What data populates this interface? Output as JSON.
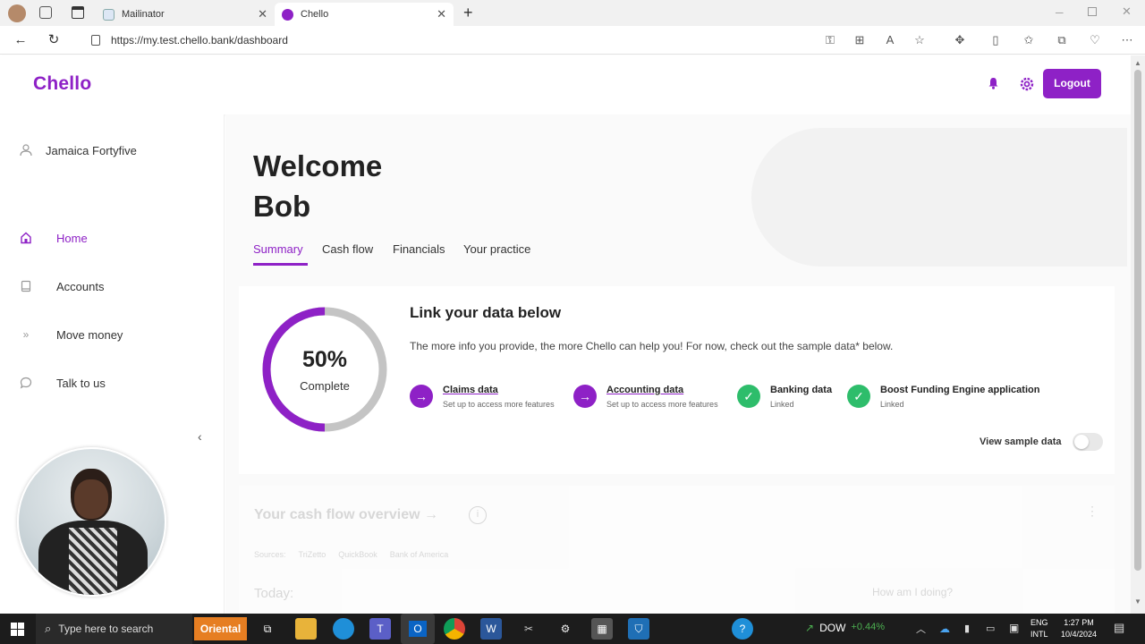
{
  "browser": {
    "tabs": [
      {
        "title": "Mailinator",
        "active": false
      },
      {
        "title": "Chello",
        "active": true
      }
    ],
    "url": "https://my.test.chello.bank/dashboard"
  },
  "header": {
    "logo": "Chello",
    "logout_label": "Logout"
  },
  "sidebar": {
    "user_name": "Jamaica Fortyfive",
    "items": [
      {
        "label": "Home",
        "active": true,
        "icon": "home-icon"
      },
      {
        "label": "Accounts",
        "active": false,
        "icon": "accounts-icon"
      },
      {
        "label": "Move money",
        "active": false,
        "icon": "move-money-icon"
      },
      {
        "label": "Talk to us",
        "active": false,
        "icon": "chat-icon"
      }
    ]
  },
  "main": {
    "welcome_line1": "Welcome",
    "welcome_line2": "Bob",
    "tabs": [
      {
        "label": "Summary",
        "active": true
      },
      {
        "label": "Cash flow",
        "active": false
      },
      {
        "label": "Financials",
        "active": false
      },
      {
        "label": "Your practice",
        "active": false
      }
    ],
    "progress": {
      "percent_label": "50%",
      "complete_label": "Complete",
      "value": 0.5
    },
    "link_card": {
      "title": "Link your data below",
      "description": "The more info you provide, the more Chello can help you! For now, check out the sample data* below.",
      "steps": [
        {
          "title": "Claims data",
          "subtitle": "Set up to access more features",
          "status": "pending"
        },
        {
          "title": "Accounting data",
          "subtitle": "Set up to access more features",
          "status": "pending"
        },
        {
          "title": "Banking data",
          "subtitle": "Linked",
          "status": "linked"
        },
        {
          "title": "Boost Funding Engine application",
          "subtitle": "Linked",
          "status": "linked"
        }
      ],
      "toggle_label": "View sample data",
      "toggle_on": false
    },
    "cashflow": {
      "title": "Your cash flow overview",
      "sources_label": "Sources:",
      "sources": [
        "TriZetto",
        "QuickBook",
        "Bank of America"
      ],
      "today_label": "Today:",
      "how_label": "How am I doing?"
    }
  },
  "taskbar": {
    "search_placeholder": "Type here to search",
    "oriental_label": "Oriental",
    "stock_name": "DOW",
    "stock_change": "+0.44%",
    "lang_line1": "ENG",
    "lang_line2": "INTL",
    "time": "1:27 PM",
    "date": "10/4/2024"
  },
  "colors": {
    "accent": "#8e21c6",
    "success": "#2ebd6b",
    "progress_track": "#c4c4c4"
  }
}
